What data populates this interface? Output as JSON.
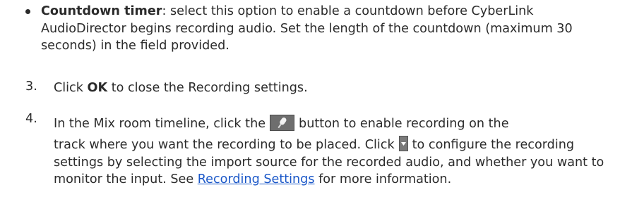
{
  "countdown": {
    "term": "Countdown timer",
    "text": ": select this option to enable a countdown before CyberLink AudioDirector begins recording audio. Set the length of the countdown (maximum 30 seconds) in the field provided."
  },
  "step3": {
    "number": "3.",
    "pre": "Click ",
    "bold": "OK",
    "post": " to close the Recording settings."
  },
  "step4": {
    "number": "4.",
    "part1": "In the Mix room timeline, click the",
    "part2": "button to enable recording on the",
    "part3": "track where you want the recording to be placed. Click",
    "part4": "to configure the recording settings by selecting the import source for the recorded audio, and whether you want to monitor the input. See",
    "link": "Recording Settings",
    "part5": " for more information.",
    "mic_icon": "microphone-record-icon",
    "dropdown_icon": "dropdown-arrow-icon"
  }
}
